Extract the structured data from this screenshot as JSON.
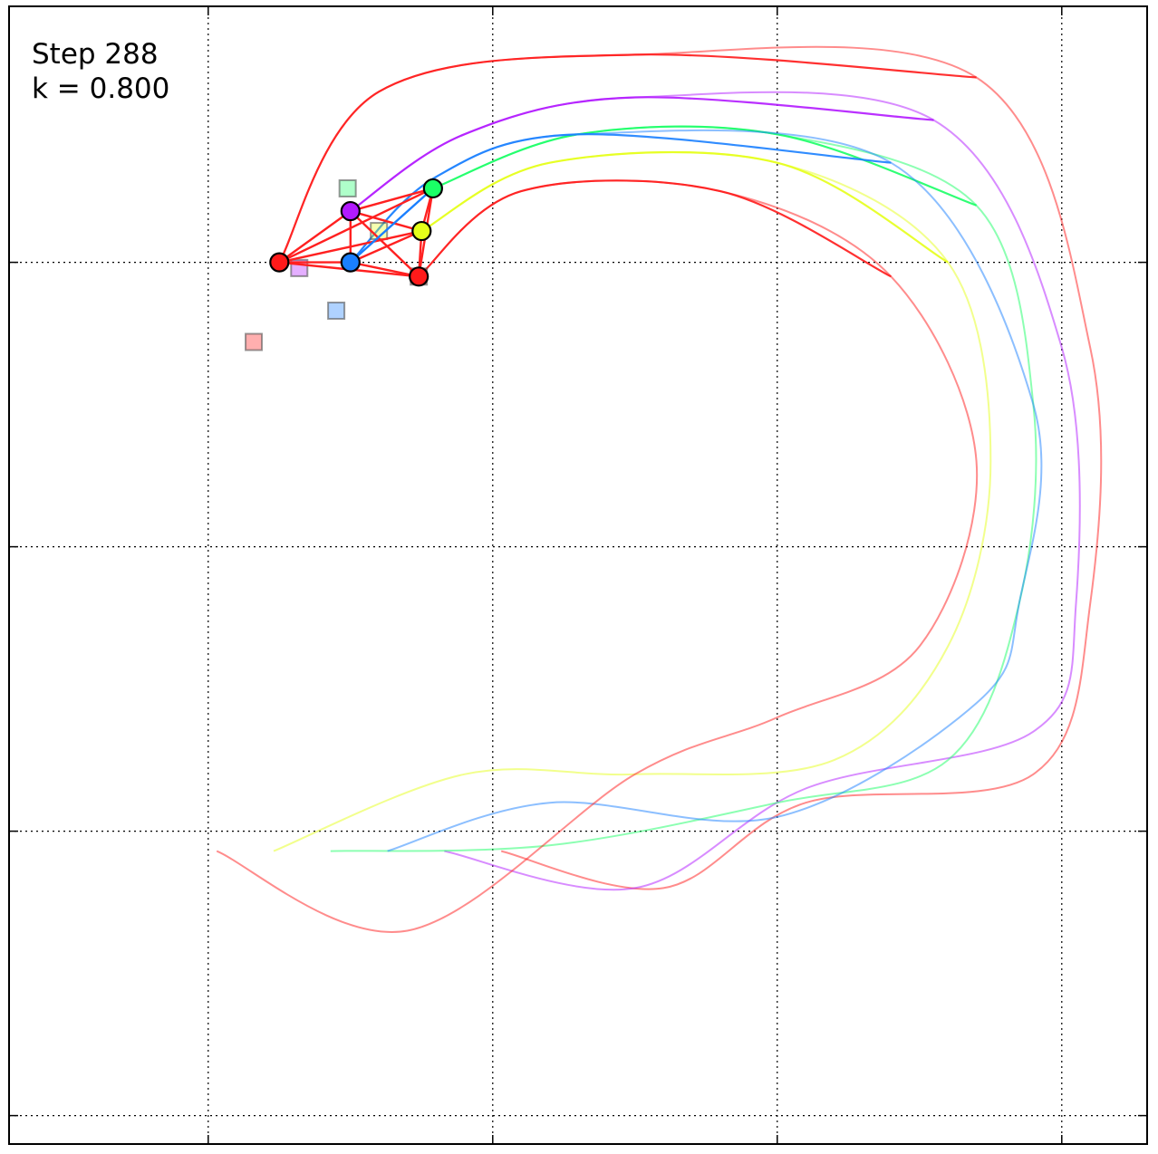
{
  "annotation": {
    "step_label": "Step 288",
    "k_label": "k = 0.800"
  },
  "colors": {
    "frame": "#000000",
    "grid": "#000000",
    "edge": "#ff2020",
    "red": "#ff1a1a",
    "purple": "#b21aff",
    "green": "#1aff66",
    "blue": "#1a7fff",
    "yellow": "#e5ff1a",
    "red2": "#ff1a1a"
  },
  "chart_data": {
    "type": "trajectory",
    "grid": true,
    "xlim": [
      -0.7,
      3.3
    ],
    "ylim": [
      -3.1,
      0.9
    ],
    "x_gridlines": [
      0,
      1,
      2,
      3
    ],
    "y_gridlines": [
      0,
      -1,
      -2,
      -3
    ],
    "agents": [
      {
        "id": "red-left",
        "color": "#ff1a1a",
        "pos": [
          0.25,
          0.0
        ],
        "target": [
          0.16,
          -0.28
        ],
        "trail_start": [
          0.25,
          0.0
        ],
        "trail_end": [
          1.03,
          -2.07
        ],
        "trail_ctrl": [
          [
            0.6,
            0.6
          ],
          [
            1.5,
            0.73
          ],
          [
            2.7,
            0.65
          ],
          [
            3.1,
            -0.3
          ],
          [
            3.1,
            -1.2
          ],
          [
            2.9,
            -1.8
          ],
          [
            2.1,
            -1.9
          ],
          [
            1.6,
            -2.2
          ],
          [
            1.03,
            -2.07
          ]
        ]
      },
      {
        "id": "purple",
        "color": "#b21aff",
        "pos": [
          0.5,
          0.18
        ],
        "target": [
          0.32,
          -0.02
        ],
        "trail_start": [
          0.5,
          0.18
        ],
        "trail_end": [
          0.83,
          -2.07
        ],
        "trail_ctrl": [
          [
            0.9,
            0.45
          ],
          [
            1.5,
            0.58
          ],
          [
            2.55,
            0.5
          ],
          [
            3.0,
            -0.3
          ],
          [
            3.05,
            -1.2
          ],
          [
            2.9,
            -1.65
          ],
          [
            2.1,
            -1.85
          ],
          [
            1.5,
            -2.2
          ],
          [
            0.83,
            -2.07
          ]
        ]
      },
      {
        "id": "green",
        "color": "#1aff66",
        "pos": [
          0.79,
          0.26
        ],
        "target": [
          0.49,
          0.26
        ],
        "trail_start": [
          0.79,
          0.26
        ],
        "trail_end": [
          0.43,
          -2.07
        ],
        "trail_ctrl": [
          [
            1.3,
            0.45
          ],
          [
            2.0,
            0.45
          ],
          [
            2.7,
            0.2
          ],
          [
            2.9,
            -0.5
          ],
          [
            2.85,
            -1.2
          ],
          [
            2.6,
            -1.75
          ],
          [
            2.0,
            -1.9
          ],
          [
            1.2,
            -2.05
          ],
          [
            0.43,
            -2.07
          ]
        ]
      },
      {
        "id": "blue",
        "color": "#1a7fff",
        "pos": [
          0.5,
          0.0
        ],
        "target": [
          0.45,
          -0.17
        ],
        "trail_start": [
          0.5,
          0.0
        ],
        "trail_end": [
          0.63,
          -2.07
        ],
        "trail_ctrl": [
          [
            0.8,
            0.3
          ],
          [
            1.3,
            0.45
          ],
          [
            2.4,
            0.35
          ],
          [
            2.9,
            -0.5
          ],
          [
            2.85,
            -1.2
          ],
          [
            2.7,
            -1.55
          ],
          [
            2.0,
            -1.95
          ],
          [
            1.2,
            -1.9
          ],
          [
            0.63,
            -2.07
          ]
        ]
      },
      {
        "id": "yellow",
        "color": "#e5ff1a",
        "pos": [
          0.75,
          0.11
        ],
        "target": [
          0.6,
          0.11
        ],
        "trail_start": [
          0.75,
          0.11
        ],
        "trail_end": [
          0.23,
          -2.07
        ],
        "trail_ctrl": [
          [
            1.2,
            0.35
          ],
          [
            2.0,
            0.35
          ],
          [
            2.6,
            0.0
          ],
          [
            2.75,
            -0.7
          ],
          [
            2.6,
            -1.35
          ],
          [
            2.2,
            -1.75
          ],
          [
            1.5,
            -1.8
          ],
          [
            0.9,
            -1.8
          ],
          [
            0.23,
            -2.07
          ]
        ]
      },
      {
        "id": "red-right",
        "color": "#ff1a1a",
        "pos": [
          0.74,
          -0.05
        ],
        "target": [
          0.74,
          -0.05
        ],
        "trail_start": [
          0.74,
          -0.05
        ],
        "trail_end": [
          0.03,
          -2.07
        ],
        "trail_ctrl": [
          [
            1.1,
            0.25
          ],
          [
            1.8,
            0.25
          ],
          [
            2.4,
            -0.05
          ],
          [
            2.7,
            -0.7
          ],
          [
            2.5,
            -1.35
          ],
          [
            2.0,
            -1.6
          ],
          [
            1.5,
            -1.8
          ],
          [
            0.7,
            -2.35
          ],
          [
            0.03,
            -2.07
          ]
        ]
      }
    ],
    "edges": [
      [
        "red-left",
        "purple"
      ],
      [
        "red-left",
        "green"
      ],
      [
        "red-left",
        "yellow"
      ],
      [
        "red-left",
        "blue"
      ],
      [
        "red-left",
        "red-right"
      ],
      [
        "purple",
        "green"
      ],
      [
        "purple",
        "yellow"
      ],
      [
        "purple",
        "blue"
      ],
      [
        "purple",
        "red-right"
      ],
      [
        "green",
        "yellow"
      ],
      [
        "green",
        "red-right"
      ],
      [
        "blue",
        "yellow"
      ],
      [
        "blue",
        "red-right"
      ],
      [
        "yellow",
        "red-right"
      ]
    ]
  }
}
